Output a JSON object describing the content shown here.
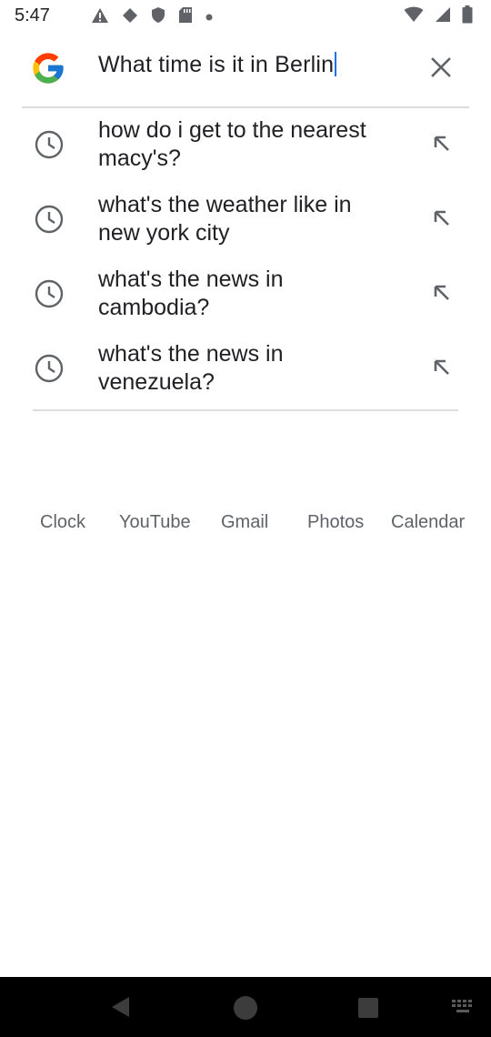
{
  "status_bar": {
    "time": "5:47",
    "left_icons": [
      "alert-triangle-icon",
      "play-protect-icon",
      "shield-icon",
      "sd-card-icon",
      "dot-icon"
    ],
    "right_icons": [
      "wifi-icon",
      "signal-icon",
      "battery-icon"
    ]
  },
  "search": {
    "query": "What time is it in Berlin",
    "clear_icon": "close-icon"
  },
  "suggestions": [
    {
      "text": "how do i get to the nearest macy's?",
      "icon": "history-clock-icon"
    },
    {
      "text": "what's the weather like in new york city",
      "icon": "history-clock-icon"
    },
    {
      "text": "what's the news in cambodia?",
      "icon": "history-clock-icon"
    },
    {
      "text": "what's the news in venezuela?",
      "icon": "history-clock-icon"
    }
  ],
  "apps": [
    {
      "label": "Clock"
    },
    {
      "label": "YouTube"
    },
    {
      "label": "Gmail"
    },
    {
      "label": "Photos"
    },
    {
      "label": "Calendar"
    }
  ],
  "colors": {
    "accent": "#1a73e8",
    "text_primary": "#202124",
    "text_secondary": "#5f6368",
    "icon_gray": "#5f6368",
    "divider": "#dadce0",
    "nav_bar": "#000000"
  }
}
